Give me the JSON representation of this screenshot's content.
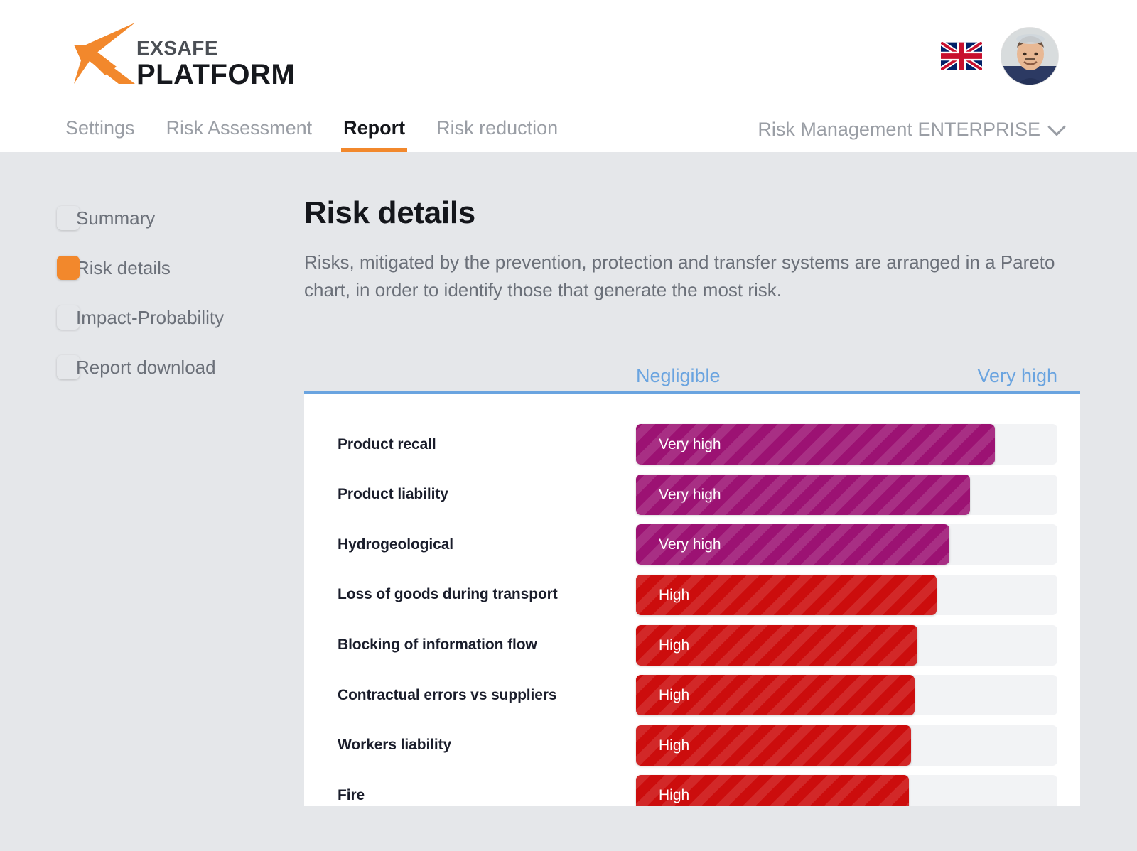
{
  "brand": {
    "logo_mark": "x-logo-icon",
    "name_top": "EXSAFE",
    "name_bottom": "PLATFORM",
    "accent_color": "#f2882c"
  },
  "header": {
    "language_flag": "uk-flag-icon",
    "avatar": "user-avatar",
    "org_switcher": {
      "label": "Risk Management ENTERPRISE",
      "icon": "chevron-down-icon"
    },
    "nav": [
      {
        "label": "Settings",
        "active": false
      },
      {
        "label": "Risk Assessment",
        "active": false
      },
      {
        "label": "Report",
        "active": true
      },
      {
        "label": "Risk reduction",
        "active": false
      }
    ]
  },
  "sidebar": {
    "items": [
      {
        "label": "Summary",
        "active": false
      },
      {
        "label": "Risk details",
        "active": true
      },
      {
        "label": "Impact-Probability",
        "active": false
      },
      {
        "label": "Report download",
        "active": false
      }
    ]
  },
  "main": {
    "title": "Risk details",
    "description": "Risks, mitigated by the prevention, protection and transfer systems are arranged in a Pareto chart, in order to identify those that generate the most risk."
  },
  "chart_data": {
    "type": "bar",
    "title": "Risk details",
    "orientation": "horizontal",
    "axis_labels": {
      "left": "Negligible",
      "right": "Very high"
    },
    "axis_label_color": "#6aa4e0",
    "xlabel": "",
    "ylabel": "",
    "xlim": [
      0,
      100
    ],
    "grid": false,
    "legend": "none",
    "value_colors": {
      "Very high": "#9c1273",
      "High": "#cc0d0d"
    },
    "categories": [
      "Product recall",
      "Product liability",
      "Hydrogeological",
      "Loss of goods during transport",
      "Blocking of information flow",
      "Contractual errors vs suppliers",
      "Workers liability",
      "Fire"
    ],
    "values": [
      85.2,
      79.3,
      74.3,
      71.4,
      66.8,
      66.1,
      65.3,
      64.8
    ],
    "bar_labels": [
      "Very high",
      "Very high",
      "Very high",
      "High",
      "High",
      "High",
      "High",
      "High"
    ],
    "levels": [
      "very-high",
      "very-high",
      "very-high",
      "high",
      "high",
      "high",
      "high",
      "high"
    ]
  }
}
